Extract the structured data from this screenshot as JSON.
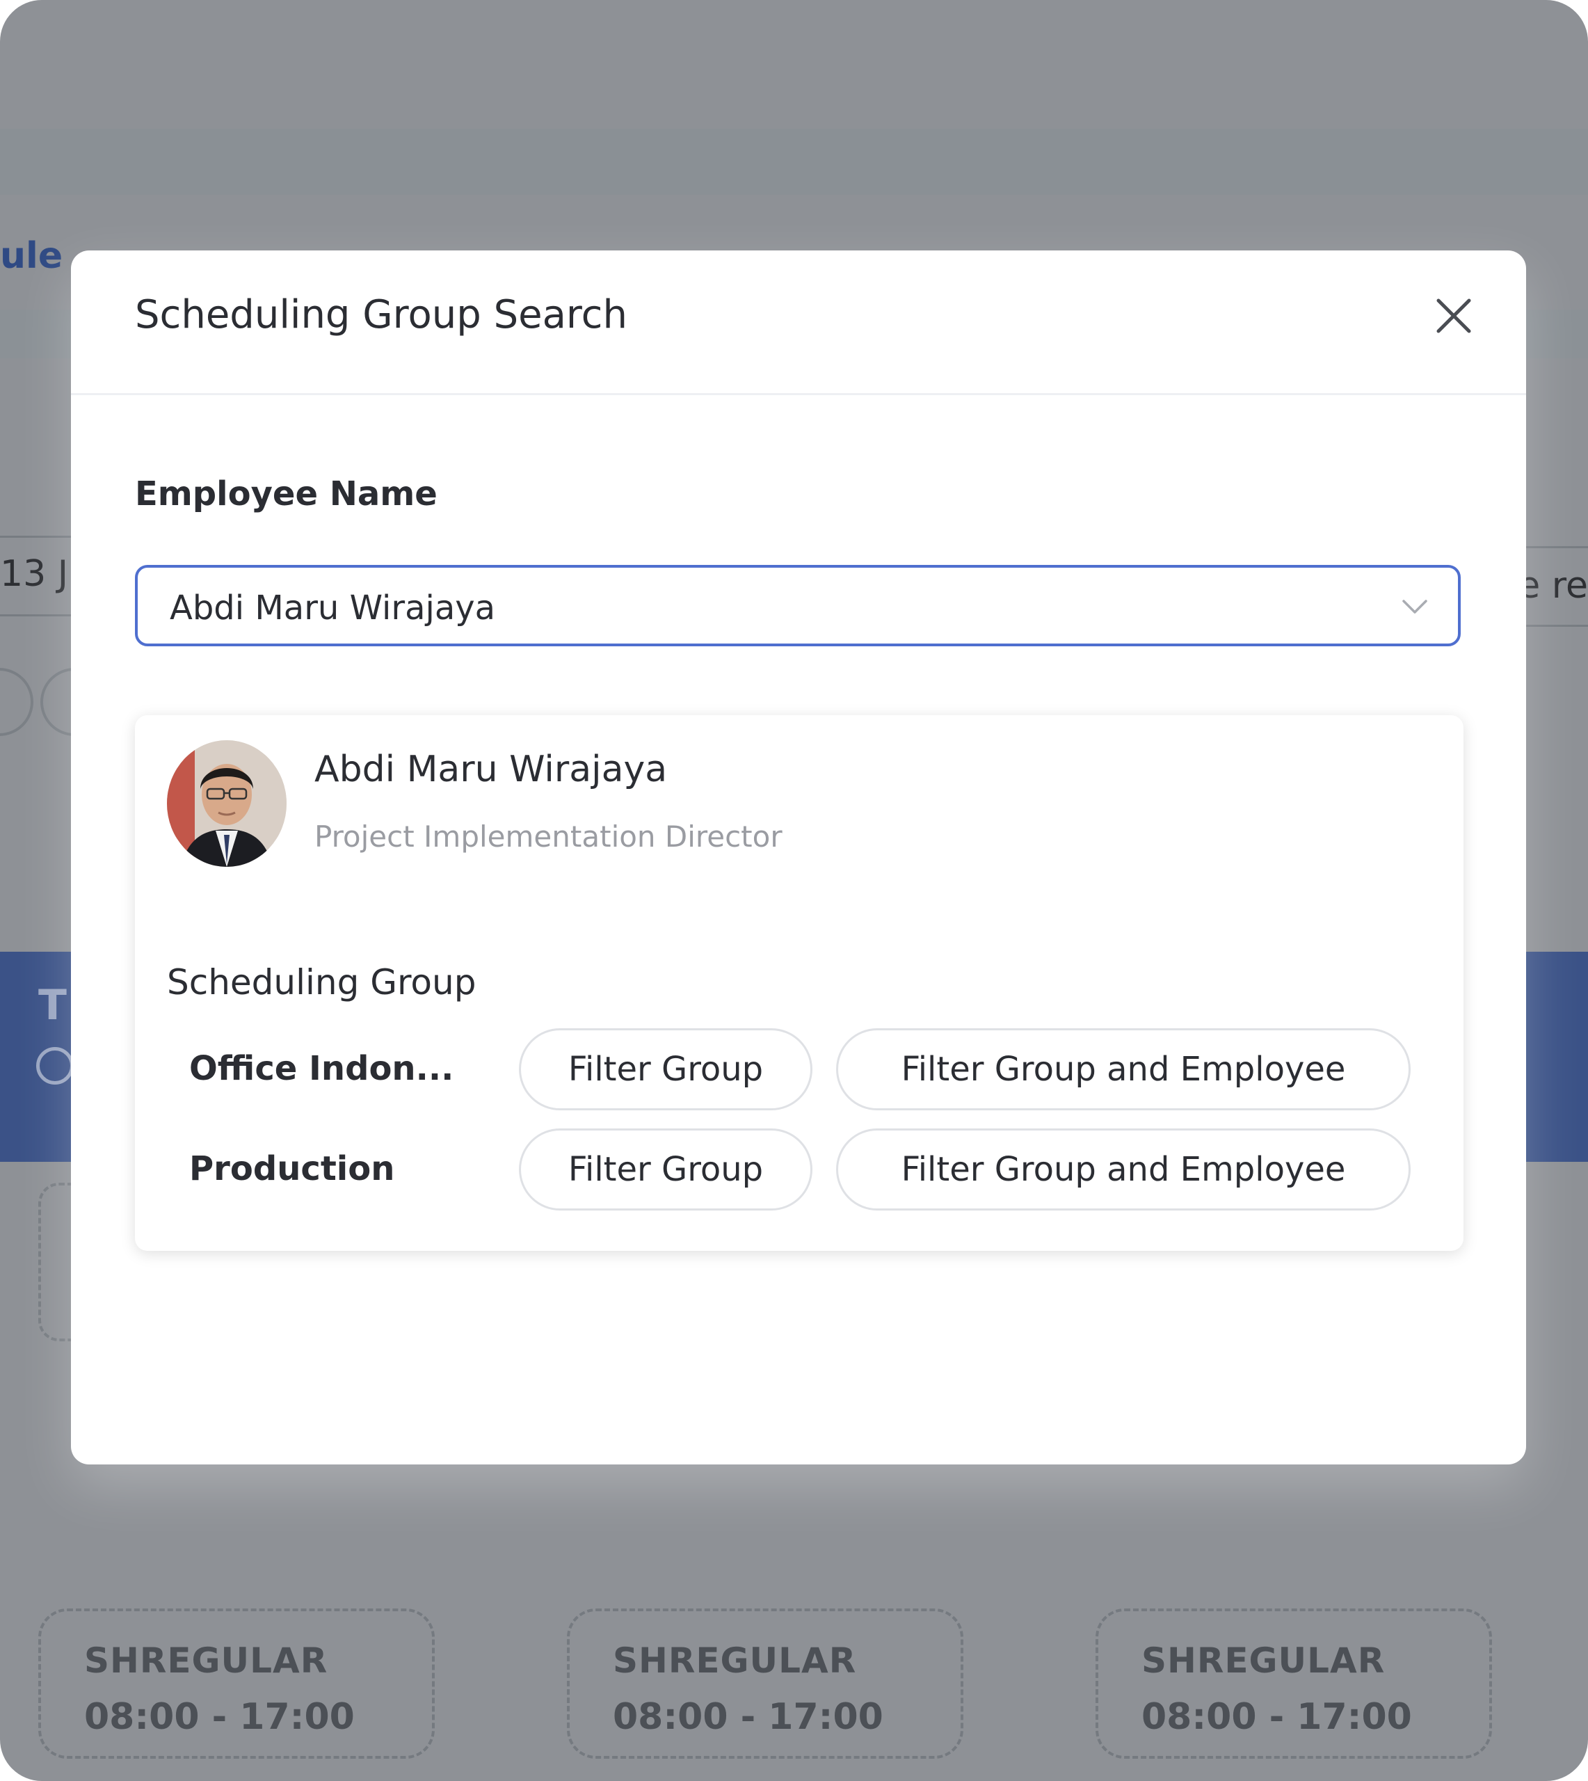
{
  "background": {
    "page_title_fragment": "ule",
    "date_fragment": "13 J",
    "right_fragment": "e re",
    "banner_fragment": "T",
    "shifts": [
      {
        "code": "SHREGULAR",
        "time": "08:00 - 17:00"
      },
      {
        "code": "SHREGULAR",
        "time": "08:00 - 17:00"
      },
      {
        "code": "SHREGULAR",
        "time": "08:00 - 17:00"
      }
    ]
  },
  "modal": {
    "title": "Scheduling Group Search",
    "close_icon": "close-icon",
    "field_label": "Employee Name",
    "selected_employee": "Abdi Maru Wirajaya",
    "dropdown_icon": "chevron-down-icon",
    "result": {
      "name": "Abdi Maru Wirajaya",
      "role": "Project Implementation Director",
      "group_heading": "Scheduling Group",
      "groups": [
        {
          "name": "Office Indon...",
          "filter_group_label": "Filter Group",
          "filter_group_employee_label": "Filter Group and Employee"
        },
        {
          "name": "Production",
          "filter_group_label": "Filter Group",
          "filter_group_employee_label": "Filter Group and Employee"
        }
      ]
    }
  },
  "colors": {
    "overlay": "#8e9196",
    "accent_border": "#4f6fcf",
    "banner_blue": "#3b5287",
    "text_primary": "#2b2d33",
    "text_secondary": "#9a9ca2"
  }
}
